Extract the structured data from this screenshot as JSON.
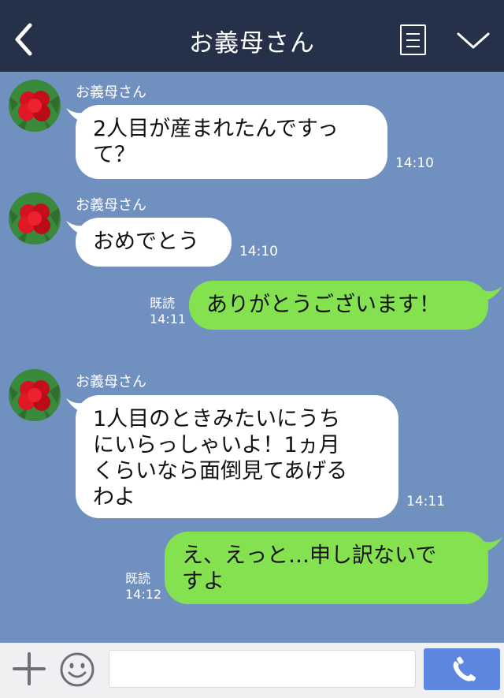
{
  "header": {
    "title": "お義母さん",
    "back_icon": "chevron-left-icon",
    "menu_icon": "list-icon",
    "collapse_icon": "chevron-down-icon"
  },
  "colors": {
    "header_bg": "#253049",
    "chat_bg": "#7090bf",
    "outgoing_bubble": "#84e14f",
    "incoming_bubble": "#ffffff",
    "send_button": "#5c86e0"
  },
  "messages": [
    {
      "direction": "incoming",
      "sender": "お義母さん",
      "text": "2人目が産まれたんですっ\nて？",
      "time": "14:10"
    },
    {
      "direction": "incoming",
      "sender": "お義母さん",
      "text": "おめでとう",
      "time": "14:10"
    },
    {
      "direction": "outgoing",
      "read": "既読",
      "text": "ありがとうございます！",
      "time": "14:11"
    },
    {
      "direction": "incoming",
      "sender": "お義母さん",
      "text": "1人目のときみたいにうち\nにいらっしゃいよ！1ヵ月\nくらいなら面倒見てあげる\nわよ",
      "time": "14:11"
    },
    {
      "direction": "outgoing",
      "read": "既読",
      "text": "え、えっと…申し訳ないで\nすよ",
      "time": "14:12"
    }
  ],
  "footer": {
    "plus_icon": "plus-icon",
    "emoji_icon": "smiley-icon",
    "input_value": "",
    "call_icon": "phone-icon"
  }
}
